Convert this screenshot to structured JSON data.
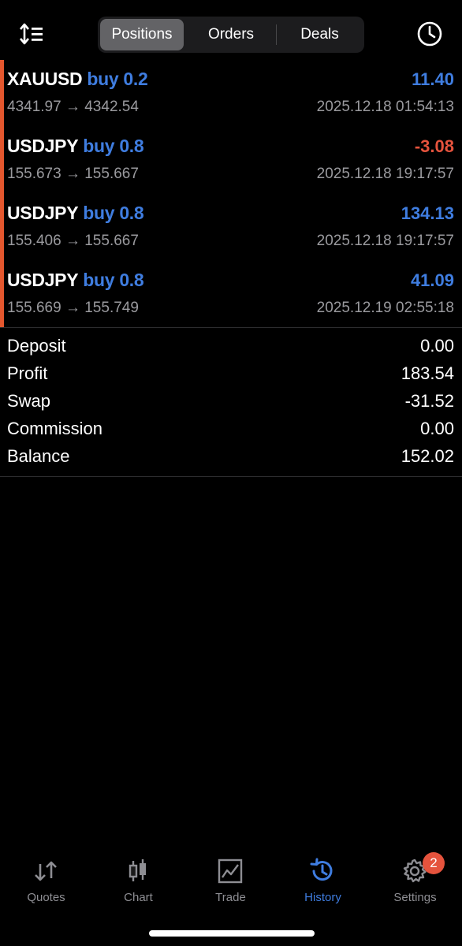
{
  "header": {
    "tabs": [
      {
        "label": "Positions",
        "active": true
      },
      {
        "label": "Orders",
        "active": false
      },
      {
        "label": "Deals",
        "active": false
      }
    ],
    "sort_icon": "sort-icon",
    "period_icon": "clock-icon"
  },
  "positions": [
    {
      "symbol": "XAUUSD",
      "side": "buy 0.2",
      "profit": "11.40",
      "profit_color": "#3f7de0",
      "prices": "4341.97 → 4342.54",
      "time": "2025.12.18 01:54:13"
    },
    {
      "symbol": "USDJPY",
      "side": "buy 0.8",
      "profit": "-3.08",
      "profit_color": "#e5533d",
      "prices": "155.673 → 155.667",
      "time": "2025.12.18 19:17:57"
    },
    {
      "symbol": "USDJPY",
      "side": "buy 0.8",
      "profit": "134.13",
      "profit_color": "#3f7de0",
      "prices": "155.406 → 155.667",
      "time": "2025.12.18 19:17:57"
    },
    {
      "symbol": "USDJPY",
      "side": "buy 0.8",
      "profit": "41.09",
      "profit_color": "#3f7de0",
      "prices": "155.669 → 155.749",
      "time": "2025.12.19 02:55:18"
    }
  ],
  "summary": [
    {
      "label": "Deposit",
      "value": "0.00"
    },
    {
      "label": "Profit",
      "value": "183.54"
    },
    {
      "label": "Swap",
      "value": "-31.52"
    },
    {
      "label": "Commission",
      "value": "0.00"
    },
    {
      "label": "Balance",
      "value": "152.02"
    }
  ],
  "nav": {
    "items": [
      {
        "label": "Quotes",
        "icon": "quotes-icon"
      },
      {
        "label": "Chart",
        "icon": "chart-icon"
      },
      {
        "label": "Trade",
        "icon": "trade-icon"
      },
      {
        "label": "History",
        "icon": "history-icon"
      },
      {
        "label": "Settings",
        "icon": "settings-icon"
      }
    ],
    "active": "History",
    "settings_badge": "2"
  },
  "colors": {
    "accent": "#3f7de0",
    "loss": "#e5533d",
    "position_bar": "#e4572e"
  }
}
